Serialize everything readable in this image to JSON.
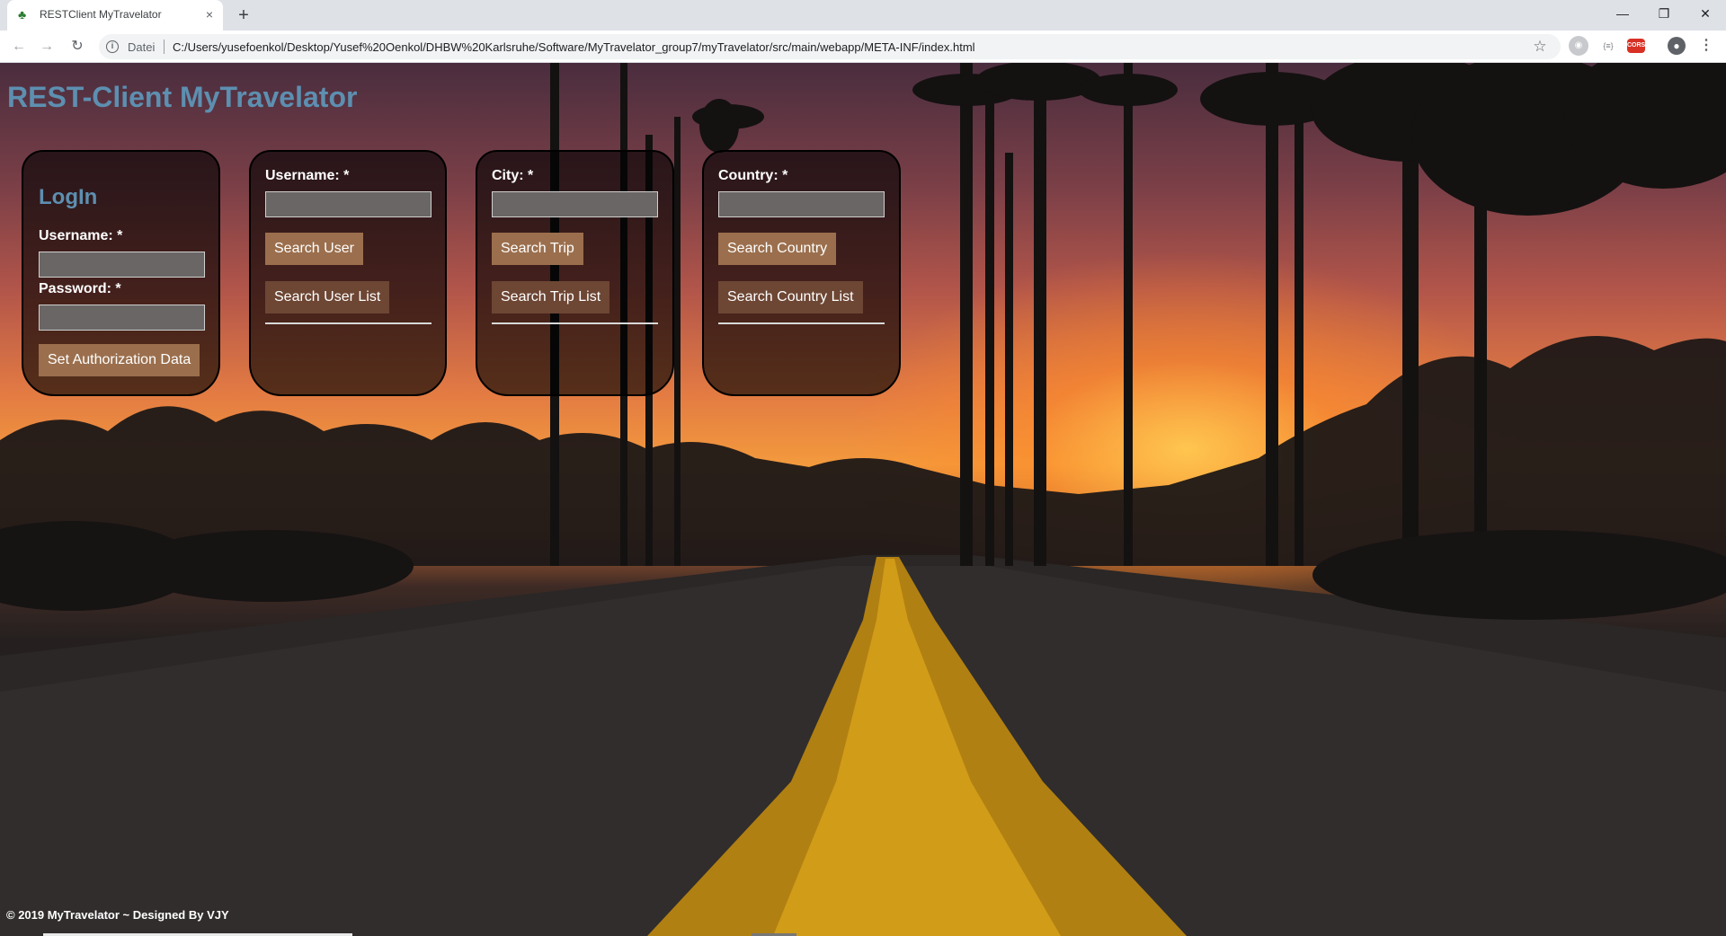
{
  "browser": {
    "tab_title": "RESTClient MyTravelator",
    "tab_close": "×",
    "new_tab": "+",
    "scheme_label": "Datei",
    "url": "C:/Users/yusefoenkol/Desktop/Yusef%20Oenkol/DHBW%20Karlsruhe/Software/MyTravelator_group7/myTravelator/src/main/webapp/META-INF/index.html",
    "icons": [
      "back-icon",
      "forward-icon",
      "reload-icon",
      "info-icon",
      "star-icon",
      "extension-icons",
      "account-icon",
      "menu-icon"
    ]
  },
  "page": {
    "title": "REST-Client MyTravelator",
    "login": {
      "heading": "LogIn",
      "username_label": "Username: *",
      "password_label": "Password: *",
      "submit_label": "Set Authorization Data"
    },
    "user": {
      "username_label": "Username: *",
      "search_label": "Search User",
      "list_label": "Search User List"
    },
    "trip": {
      "city_label": "City: *",
      "search_label": "Search Trip",
      "list_label": "Search Trip List"
    },
    "country": {
      "country_label": "Country: *",
      "search_label": "Search Country",
      "list_label": "Search Country List"
    },
    "footer": "© 2019 MyTravelator ~ Designed By VJY"
  },
  "colors": {
    "title": "#5d8fb0",
    "button": "#9b6f4d",
    "button_dark": "#6d4634",
    "card_bg": "rgba(0,0,0,0.62)"
  }
}
